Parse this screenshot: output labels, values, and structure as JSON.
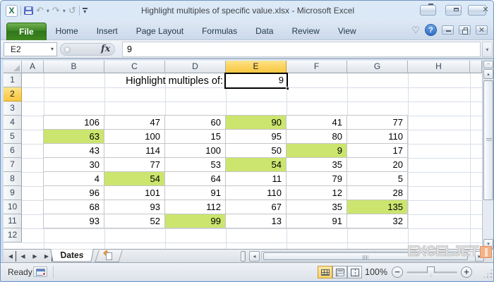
{
  "window": {
    "title": "Highlight multiples of specific value.xlsx  -  Microsoft Excel",
    "app_initial": "X"
  },
  "qat": {
    "undo_icon": "↶",
    "redo_icon": "↷",
    "repeat_icon": "↺",
    "dropdown_icon": "▾"
  },
  "ribbon": {
    "file_tab": "File",
    "tabs": [
      "Home",
      "Insert",
      "Page Layout",
      "Formulas",
      "Data",
      "Review",
      "View"
    ],
    "heart_icon": "♡",
    "help_icon": "?"
  },
  "formula_bar": {
    "cell_ref": "E2",
    "fx_label": "fx",
    "value": "9",
    "dropdown_icon": "▾",
    "expand_icon": "▾"
  },
  "sheet": {
    "columns": [
      "A",
      "B",
      "C",
      "D",
      "E",
      "F",
      "G",
      "H",
      ""
    ],
    "selected_column": "E",
    "rows": [
      "1",
      "2",
      "3",
      "4",
      "5",
      "6",
      "7",
      "8",
      "9",
      "10",
      "11",
      "12"
    ],
    "selected_row": "2",
    "label": "Highlight multiples of:",
    "selected_cell": {
      "ref": "E2",
      "value": "9"
    },
    "table": {
      "origin": "B4",
      "values": [
        [
          106,
          47,
          60,
          90,
          41,
          77
        ],
        [
          63,
          100,
          15,
          95,
          80,
          110
        ],
        [
          43,
          114,
          100,
          50,
          9,
          17
        ],
        [
          30,
          77,
          53,
          54,
          35,
          20
        ],
        [
          4,
          54,
          64,
          11,
          79,
          5
        ],
        [
          96,
          101,
          91,
          110,
          12,
          28
        ],
        [
          68,
          93,
          112,
          67,
          35,
          135
        ],
        [
          93,
          52,
          99,
          13,
          91,
          32
        ]
      ],
      "highlighted": [
        [
          0,
          3
        ],
        [
          1,
          0
        ],
        [
          2,
          4
        ],
        [
          3,
          3
        ],
        [
          4,
          1
        ],
        [
          6,
          5
        ],
        [
          7,
          2
        ]
      ],
      "highlight_color": "#cbe56e"
    }
  },
  "sheet_tabs": {
    "active_tab": "Dates",
    "prev_all_icon": "◀",
    "prev_icon": "◂",
    "next_icon": "▸",
    "next_all_icon": "▶",
    "scroll_left_icon": "◂",
    "scroll_right_icon": "▸"
  },
  "scrollbars": {
    "up_icon": "▴",
    "down_icon": "▾",
    "split_icon": "−"
  },
  "status_bar": {
    "mode": "Ready",
    "zoom_level": "100%",
    "zoom_out_icon": "−",
    "zoom_in_icon": "+"
  },
  "watermark": {
    "text": "EXCELJET"
  },
  "colors": {
    "highlight_green": "#cbe56e",
    "selected_header_amber": "#fbd15c",
    "file_tab_green": "#3d8422",
    "logo_orange": "#f5b285"
  }
}
